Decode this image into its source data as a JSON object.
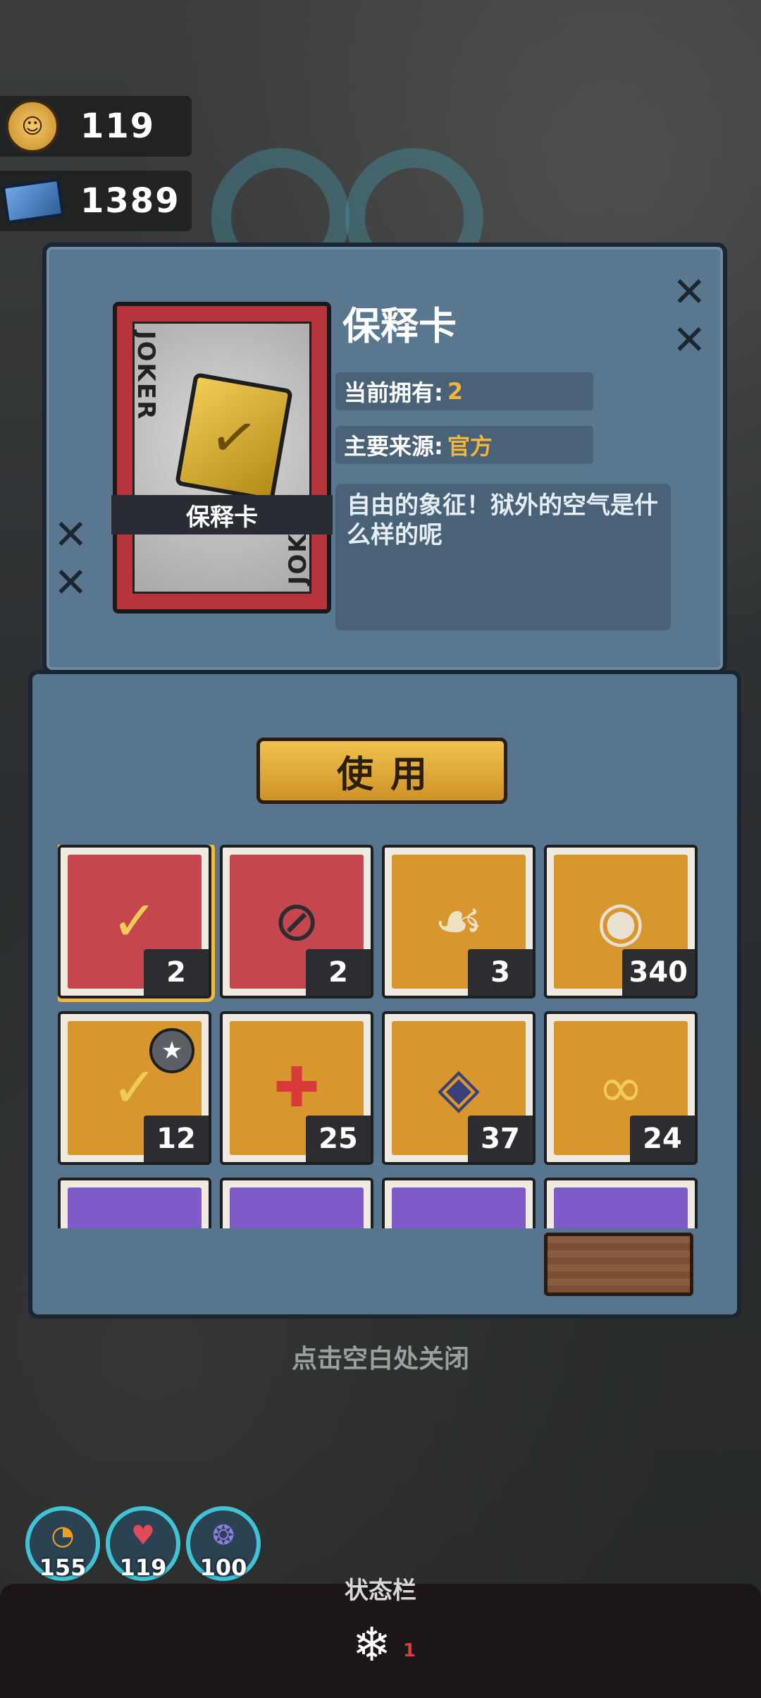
{
  "currency": [
    {
      "value": "119",
      "icon": "coin-icon"
    },
    {
      "value": "1389",
      "icon": "ticket-icon"
    }
  ],
  "item": {
    "card_label": "保释卡",
    "title": "保释卡",
    "owned_label": "当前拥有:",
    "owned_value": "2",
    "source_label": "主要来源:",
    "source_value": "官方",
    "description": "自由的象征！狱外的空气是什么样的呢",
    "joker_text": "JOKER"
  },
  "use_button_label": "使用",
  "inventory": [
    {
      "count": "2",
      "bg": "#c5474d",
      "icon": "shield-card-icon",
      "glyph": "✓",
      "selected": true
    },
    {
      "count": "2",
      "bg": "#c5474d",
      "icon": "ban-ticket-icon",
      "glyph": "⊘"
    },
    {
      "count": "3",
      "bg": "#d8962f",
      "icon": "paw-scroll-icon",
      "glyph": "☙"
    },
    {
      "count": "340",
      "bg": "#d8962f",
      "icon": "film-reel-icon",
      "glyph": "◉"
    },
    {
      "count": "12",
      "bg": "#d8962f",
      "icon": "shield-card-star-icon",
      "glyph": "✓",
      "star": true
    },
    {
      "count": "25",
      "bg": "#d8962f",
      "icon": "medical-card-icon",
      "glyph": "✚"
    },
    {
      "count": "37",
      "bg": "#d8962f",
      "icon": "steak-package-icon",
      "glyph": "◈"
    },
    {
      "count": "24",
      "bg": "#d8962f",
      "icon": "gold-card-icon",
      "glyph": "∞"
    },
    {
      "count": "",
      "bg": "#7f5bc9",
      "icon": "blue-ticket-icon",
      "glyph": ""
    },
    {
      "count": "",
      "bg": "#7f5bc9",
      "icon": "item-icon",
      "glyph": ""
    },
    {
      "count": "",
      "bg": "#7f5bc9",
      "icon": "item-icon",
      "glyph": ""
    },
    {
      "count": "",
      "bg": "#7f5bc9",
      "icon": "item-icon",
      "glyph": ""
    }
  ],
  "close_hint": "点击空白处关闭",
  "stats": [
    {
      "value": "155",
      "icon": "hunger-icon",
      "glyph": "◔"
    },
    {
      "value": "119",
      "icon": "heart-icon",
      "glyph": "♥"
    },
    {
      "value": "100",
      "icon": "brain-icon",
      "glyph": "❂"
    }
  ],
  "status_bar": {
    "title": "状态栏",
    "effect_count": "1"
  }
}
